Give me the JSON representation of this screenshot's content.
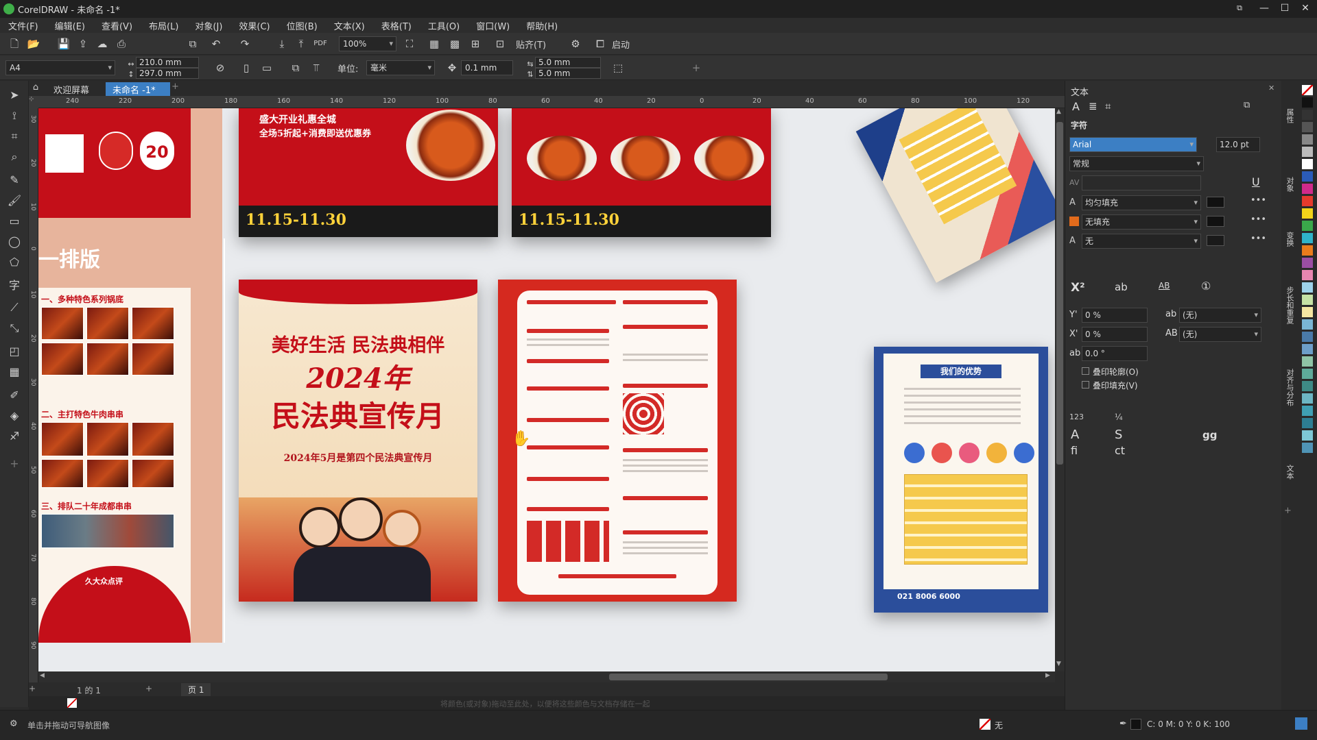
{
  "window": {
    "title": "CorelDRAW - 未命名 -1*"
  },
  "menu": [
    "文件(F)",
    "编辑(E)",
    "查看(V)",
    "布局(L)",
    "对象(J)",
    "效果(C)",
    "位图(B)",
    "文本(X)",
    "表格(T)",
    "工具(O)",
    "窗口(W)",
    "帮助(H)"
  ],
  "stdbar": {
    "zoom": "100%",
    "snap_label": "贴齐(T)",
    "launch_label": "启动"
  },
  "propbar": {
    "page_size": "A4",
    "width": "210.0 mm",
    "height": "297.0 mm",
    "unit_label": "单位:",
    "unit_value": "毫米",
    "nudge": "0.1 mm",
    "dup_x": "5.0 mm",
    "dup_y": "5.0 mm"
  },
  "tabs": [
    "欢迎屏幕",
    "未命名 -1*"
  ],
  "ruler_h": [
    "240",
    "220",
    "200",
    "180",
    "160",
    "140",
    "120",
    "100",
    "80",
    "60",
    "40",
    "20",
    "0",
    "20",
    "40",
    "60",
    "80",
    "100",
    "120"
  ],
  "ruler_v": [
    "30",
    "20",
    "10",
    "0",
    "10",
    "20",
    "30",
    "40",
    "50",
    "60",
    "70",
    "80",
    "90"
  ],
  "docker": {
    "title": "文本",
    "section": "字符",
    "font": "Arial",
    "size": "12.0 pt",
    "style": "常规",
    "fill_label": "均匀填充",
    "bg_fill_label": "无填充",
    "outline_label": "无",
    "y_offset": "0 %",
    "x_offset": "0 %",
    "angle": "0.0 °",
    "ul_none_1": "(无)",
    "ul_none_2": "(无)",
    "overprint_outline": "叠印轮廓(O)",
    "overprint_fill": "叠印填充(V)"
  },
  "right_tabs": [
    "属性",
    "对象",
    "变换",
    "步长和重复",
    "对齐与分布",
    "文本"
  ],
  "pagebar": {
    "page_count": "1 的 1",
    "page_tab": "页 1"
  },
  "doc_palette_hint": "将颜色(或对象)拖动至此处，以便将这些颜色与文档存储在一起",
  "status": {
    "hint": "单击并拖动可导航图像",
    "fill_status": "无",
    "color_readout": "C: 0 M: 0 Y: 0 K: 100"
  },
  "posters": {
    "hotpot_title": "一排版",
    "hotpot_sec1": "一、多种特色系列锅底",
    "hotpot_sec2": "二、主打特色牛肉串串",
    "hotpot_sec3": "三、排队二十年成都串串",
    "hotpot_badge1": "20",
    "hotpot_footer": "久大众点评",
    "promo_line1": "盛大开业礼惠全城",
    "promo_line2": "全场5折起+消费即送优惠券",
    "promo_date": "11.15-11.30",
    "civil_title1": "美好生活 民法典相伴",
    "civil_title2": "2024年",
    "civil_title3": "民法典宣传月",
    "civil_sub": "2024年5月是第四个民法典宣传月",
    "kids_title": "我们的优势",
    "kids_phone": "021 8006 6000",
    "colors": {
      "accent": "#3c7fc4",
      "poster_red": "#c40f19"
    }
  }
}
